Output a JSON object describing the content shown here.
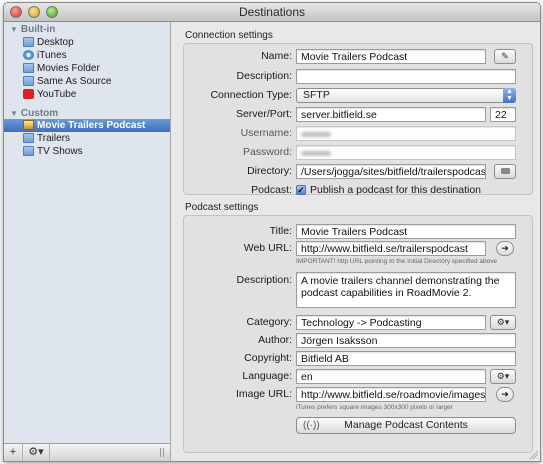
{
  "window": {
    "title": "Destinations"
  },
  "sidebar": {
    "builtin_label": "Built-in",
    "builtin_items": [
      {
        "label": "Desktop",
        "icon": "folder-icon"
      },
      {
        "label": "iTunes",
        "icon": "itunes-icon"
      },
      {
        "label": "Movies Folder",
        "icon": "folder-icon"
      },
      {
        "label": "Same As Source",
        "icon": "folder-icon"
      },
      {
        "label": "YouTube",
        "icon": "youtube-icon"
      }
    ],
    "custom_label": "Custom",
    "custom_items": [
      {
        "label": "Movie Trailers Podcast",
        "icon": "podcast-icon",
        "selected": true
      },
      {
        "label": "Trailers",
        "icon": "folder-icon"
      },
      {
        "label": "TV Shows",
        "icon": "folder-icon"
      }
    ],
    "footer": {
      "add": "+",
      "action": "⚙▾"
    }
  },
  "connection": {
    "section_title": "Connection settings",
    "name_label": "Name:",
    "name_value": "Movie Trailers Podcast",
    "description_label": "Description:",
    "description_value": "",
    "connection_type_label": "Connection Type:",
    "connection_type_value": "SFTP",
    "server_label": "Server/Port:",
    "server_value": "server.bitfield.se",
    "port_value": "22",
    "username_label": "Username:",
    "password_label": "Password:",
    "directory_label": "Directory:",
    "directory_value": "/Users/jogga/sites/bitfield/trailerspodcast",
    "podcast_label": "Podcast:",
    "podcast_checkbox_label": "Publish a podcast for this destination",
    "podcast_checked": true
  },
  "podcast": {
    "section_title": "Podcast settings",
    "title_label": "Title:",
    "title_value": "Movie Trailers Podcast",
    "weburl_label": "Web URL:",
    "weburl_value": "http://www.bitfield.se/trailerspodcast",
    "weburl_hint": "IMPORTANT! http URL pointing to the Initial Directory specified above",
    "description_label": "Description:",
    "description_value": "A movie trailers channel demonstrating the podcast capabilities in RoadMovie 2.",
    "category_label": "Category:",
    "category_value": "Technology -> Podcasting",
    "author_label": "Author:",
    "author_value": "Jörgen Isaksson",
    "copyright_label": "Copyright:",
    "copyright_value": "Bitfield AB",
    "language_label": "Language:",
    "language_value": "en",
    "imageurl_label": "Image URL:",
    "imageurl_value": "http://www.bitfield.se/roadmovie/images/podc",
    "imageurl_hint": "iTunes prefers square images 300x300 pixels or larger",
    "manage_button_label": "Manage Podcast Contents"
  }
}
